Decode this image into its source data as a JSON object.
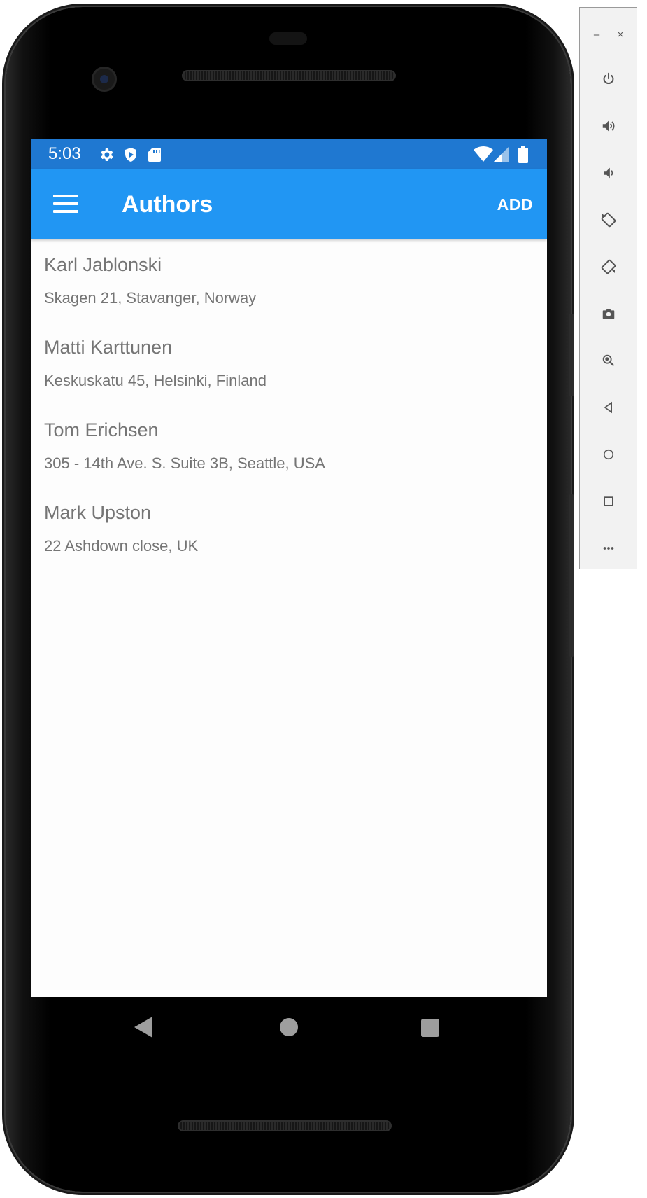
{
  "status_bar": {
    "time": "5:03",
    "icons": [
      "gear-icon",
      "play-protect-icon",
      "sd-card-icon",
      "wifi-icon",
      "signal-icon",
      "battery-icon"
    ]
  },
  "app_bar": {
    "title": "Authors",
    "add_label": "ADD",
    "menu_icon": "hamburger-icon"
  },
  "authors": [
    {
      "name": "Karl Jablonski",
      "address": "Skagen 21, Stavanger, Norway"
    },
    {
      "name": "Matti Karttunen",
      "address": "Keskuskatu 45, Helsinki, Finland"
    },
    {
      "name": "Tom Erichsen",
      "address": "305 - 14th Ave. S. Suite 3B, Seattle, USA"
    },
    {
      "name": "Mark Upston",
      "address": "22 Ashdown close, UK"
    }
  ],
  "navigation": [
    "back-icon",
    "home-icon",
    "recents-icon"
  ],
  "emulator_toolbar": {
    "window_controls": [
      "minimize-icon",
      "close-icon"
    ],
    "buttons": [
      "power-icon",
      "volume-up-icon",
      "volume-down-icon",
      "rotate-left-icon",
      "rotate-right-icon",
      "camera-icon",
      "zoom-icon",
      "back-icon",
      "home-icon",
      "overview-icon",
      "more-icon"
    ]
  },
  "colors": {
    "status_bar": "#1f78d1",
    "app_bar": "#2196f3",
    "list_text": "#757575",
    "background": "#fdfdfd"
  }
}
